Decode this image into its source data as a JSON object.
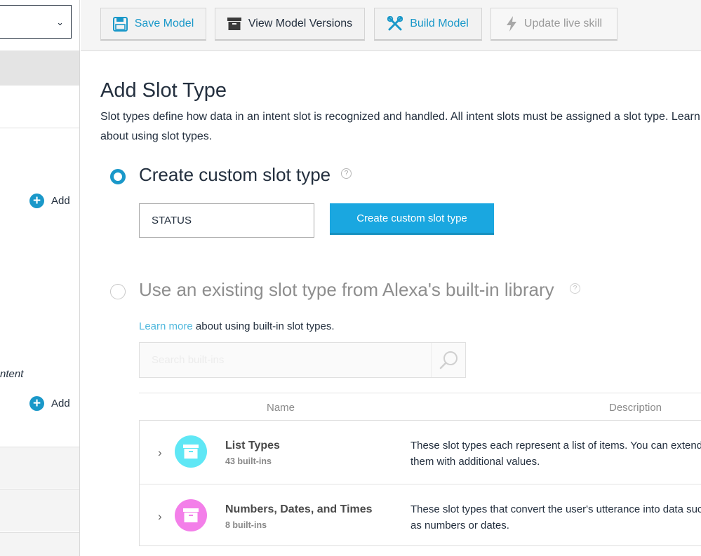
{
  "sidebar": {
    "add_label_1": "Add",
    "intent_text": "ntent",
    "add_label_2": "Add"
  },
  "toolbar": {
    "save_label": "Save Model",
    "versions_label": "View Model Versions",
    "build_label": "Build Model",
    "update_label": "Update live skill"
  },
  "main": {
    "title": "Add Slot Type",
    "description": "Slot types define how data in an intent slot is recognized and handled. All intent slots must be assigned a slot type. Learn more about using slot types.",
    "custom": {
      "label": "Create custom slot type",
      "input_value": "STATUS",
      "button_label": "Create custom slot type"
    },
    "builtin": {
      "label": "Use an existing slot type from Alexa's built-in library",
      "learn_link": "Learn more",
      "learn_rest": " about using built-in slot types.",
      "search_placeholder": "Search built-ins"
    },
    "table": {
      "headers": [
        "Name",
        "Description"
      ],
      "rows": [
        {
          "name": "List Types",
          "count": "43 built-ins",
          "description": "These slot types each represent a list of items. You can extend them with additional values.",
          "icon": "archive-box-icon",
          "color": "#5fe7f5"
        },
        {
          "name": "Numbers, Dates, and Times",
          "count": "8 built-ins",
          "description": "These slot types that convert the user's utterance into data such as numbers or dates.",
          "icon": "archive-box-icon",
          "color": "#f37fe9"
        }
      ]
    }
  },
  "colors": {
    "accent": "#1a98c9",
    "primary_button": "#1aa7e0",
    "link": "#50b8dd"
  }
}
